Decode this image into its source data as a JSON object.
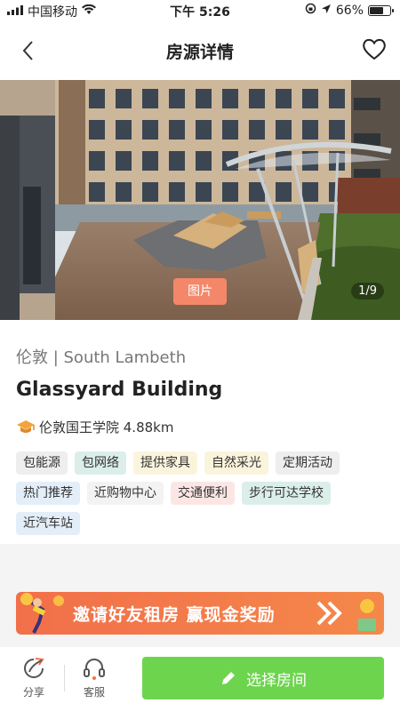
{
  "status_bar": {
    "carrier": "中国移动",
    "time": "下午 5:26",
    "battery_text": "66%",
    "battery_level": 0.66
  },
  "nav": {
    "title": "房源详情",
    "back_icon": "chevron-left-icon",
    "favorite_icon": "heart-outline-icon"
  },
  "gallery": {
    "photo_label": "图片",
    "counter": "1/9"
  },
  "property": {
    "location": "伦敦 | South Lambeth",
    "name": "Glassyard Building",
    "nearby_school": "伦敦国王学院 4.88km",
    "tags": [
      {
        "label": "包能源",
        "bg": "#eeeeee",
        "color": "#333333"
      },
      {
        "label": "包网络",
        "bg": "#dbeee9",
        "color": "#333333"
      },
      {
        "label": "提供家具",
        "bg": "#fbf4dc",
        "color": "#333333"
      },
      {
        "label": "自然采光",
        "bg": "#fbf4dc",
        "color": "#333333"
      },
      {
        "label": "定期活动",
        "bg": "#eeeeee",
        "color": "#333333"
      },
      {
        "label": "热门推荐",
        "bg": "#e3eef8",
        "color": "#333333"
      },
      {
        "label": "近购物中心",
        "bg": "#f3f3f3",
        "color": "#333333"
      },
      {
        "label": "交通便利",
        "bg": "#fbe6e4",
        "color": "#333333"
      },
      {
        "label": "步行可达学校",
        "bg": "#dbeee9",
        "color": "#333333"
      },
      {
        "label": "近汽车站",
        "bg": "#e3eef8",
        "color": "#333333"
      }
    ]
  },
  "banner": {
    "text": "邀请好友租房 赢现金奖励"
  },
  "bottom_bar": {
    "share_label": "分享",
    "service_label": "客服",
    "select_label": "选择房间"
  },
  "colors": {
    "accent_green": "#6dd44e",
    "banner_orange": "#f26f4a",
    "photo_tag": "#f4876a"
  }
}
